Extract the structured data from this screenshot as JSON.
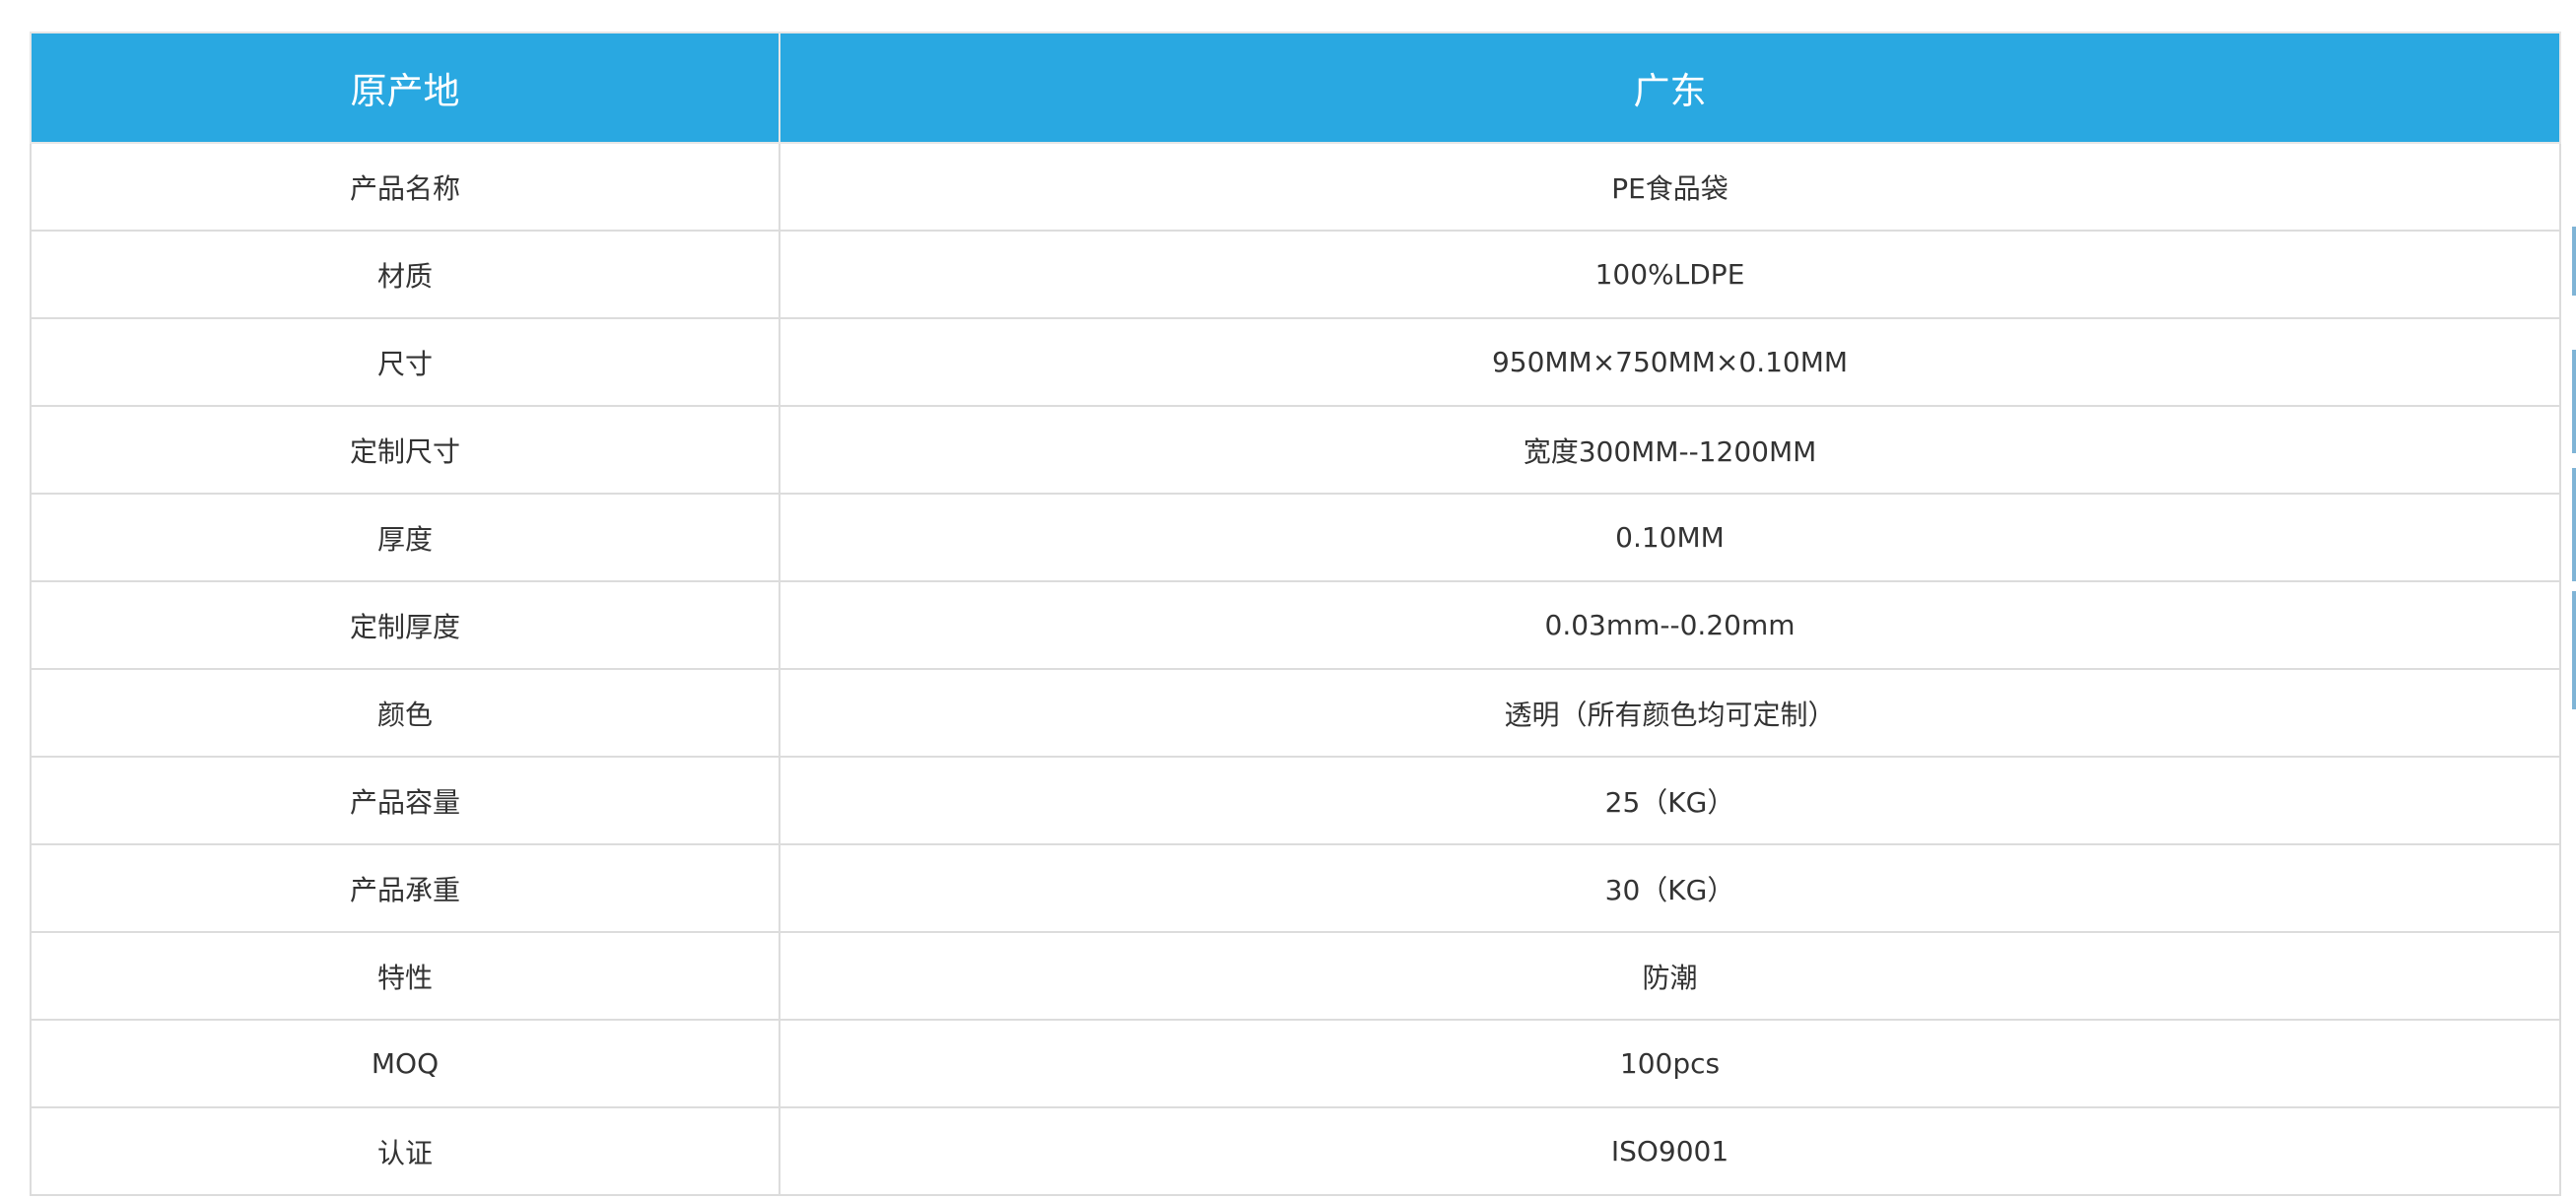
{
  "table": {
    "header": {
      "label": "原产地",
      "value": "广东"
    },
    "rows": [
      {
        "label": "产品名称",
        "value": "PE食品袋"
      },
      {
        "label": "材质",
        "value": "100%LDPE"
      },
      {
        "label": "尺寸",
        "value": "950MM×750MM×0.10MM"
      },
      {
        "label": "定制尺寸",
        "value": "宽度300MM--1200MM"
      },
      {
        "label": "厚度",
        "value": "0.10MM"
      },
      {
        "label": "定制厚度",
        "value": "0.03mm--0.20mm"
      },
      {
        "label": "颜色",
        "value": "透明（所有颜色均可定制）"
      },
      {
        "label": "产品容量",
        "value": "25（KG）"
      },
      {
        "label": "产品承重",
        "value": "30（KG）"
      },
      {
        "label": "特性",
        "value": "防潮"
      },
      {
        "label": "MOQ",
        "value": "100pcs"
      },
      {
        "label": "认证",
        "value": "ISO9001"
      }
    ]
  },
  "colors": {
    "header_bg": "#29a8e1",
    "header_text": "#ffffff",
    "border": "#dcdcdc",
    "body_text": "#333333"
  }
}
